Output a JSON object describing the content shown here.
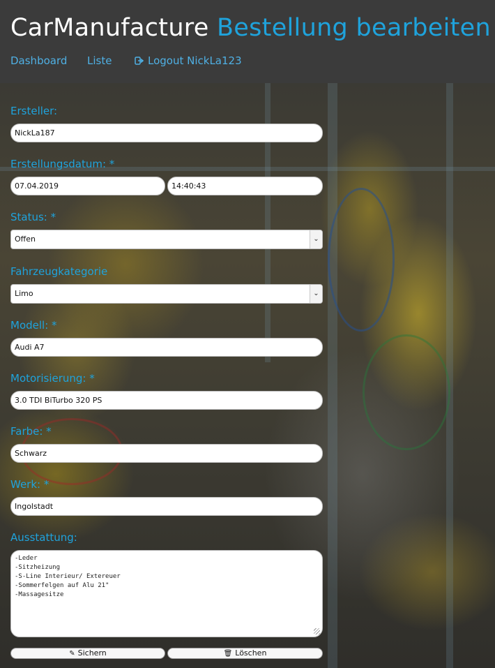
{
  "header": {
    "brand": "CarManufacture",
    "subtitle": "Bestellung bearbeiten"
  },
  "nav": {
    "dashboard": "Dashboard",
    "liste": "Liste",
    "logout": "Logout NickLa123",
    "logout_icon": "sign-out-icon"
  },
  "form": {
    "ersteller": {
      "label": "Ersteller:",
      "value": "NickLa187"
    },
    "erstellungsdatum": {
      "label": "Erstellungsdatum: *",
      "date": "07.04.2019",
      "time": "14:40:43"
    },
    "status": {
      "label": "Status: *",
      "value": "Offen"
    },
    "fahrzeugkategorie": {
      "label": "Fahrzeugkategorie",
      "value": "Limo"
    },
    "modell": {
      "label": "Modell: *",
      "value": "Audi A7"
    },
    "motorisierung": {
      "label": "Motorisierung: *",
      "value": "3.0 TDI BiTurbo 320 PS"
    },
    "farbe": {
      "label": "Farbe: *",
      "value": "Schwarz"
    },
    "werk": {
      "label": "Werk: *",
      "value": "Ingolstadt"
    },
    "ausstattung": {
      "label": "Ausstattung:",
      "value": "-Leder\n-Sitzheizung\n-S-Line Interieur/ Extereuer\n-Sommerfelgen auf Alu 21\"\n-Massagesitze"
    }
  },
  "buttons": {
    "save": "Sichern",
    "save_icon": "pencil-icon",
    "delete": "Löschen",
    "delete_icon": "trash-icon"
  },
  "colors": {
    "accent": "#1fa3dc",
    "header_bg": "#3b3b3b"
  }
}
